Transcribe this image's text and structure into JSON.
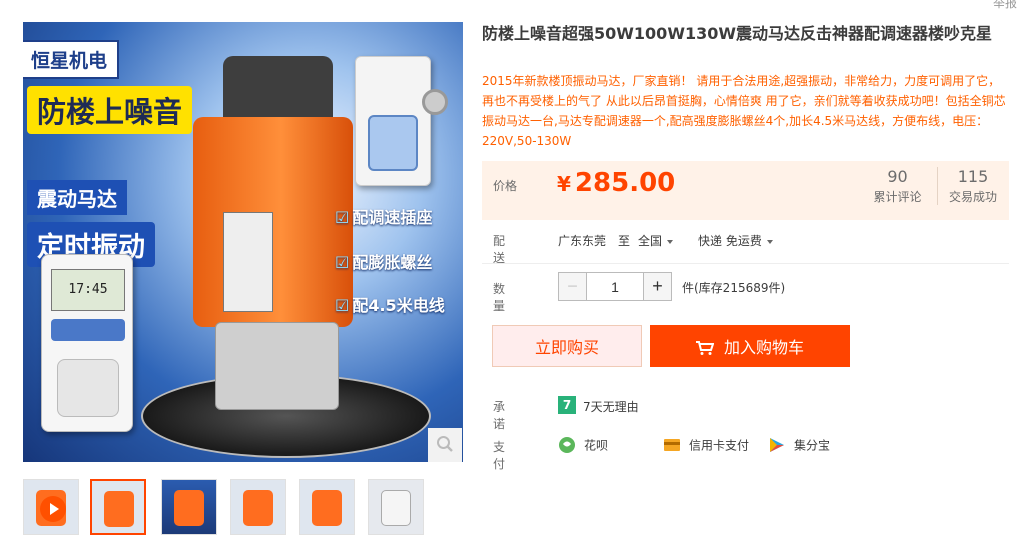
{
  "report": "举报",
  "main_image": {
    "brand": "恒星机电",
    "slogan_1": "防楼上噪音",
    "slogan_2": "震动马达",
    "slogan_3": "定时振动",
    "features": [
      "配调速插座",
      "配膨胀螺丝",
      "配4.5米电线"
    ],
    "timer_display": "17:45",
    "zoom_icon": "magnifier-icon"
  },
  "thumbnails": [
    {
      "name": "video",
      "icon": "play-icon"
    },
    {
      "name": "thumb-2",
      "active": true
    },
    {
      "name": "thumb-3"
    },
    {
      "name": "thumb-4"
    },
    {
      "name": "thumb-5"
    },
    {
      "name": "thumb-6"
    }
  ],
  "product": {
    "title": "防楼上噪音超强50W100W130W震动马达反击神器配调速器楼吵克星",
    "subtitle": "2015年新款楼顶振动马达，厂家直销！ 请用于合法用途,超强振动，非常给力，力度可调用了它，再也不再受楼上的气了 从此以后昂首挺胸，心情倍爽 用了它，亲们就等着收获成功吧！包括全铜芯振动马达一台,马达专配调速器一个,配高强度膨胀螺丝4个,加长4.5米马达线，方便布线，电压：220V,50-130W"
  },
  "price": {
    "label": "价格",
    "currency": "¥",
    "value": "285.00",
    "reviews_count": "90",
    "reviews_label": "累计评论",
    "deals_count": "115",
    "deals_label": "交易成功"
  },
  "shipping": {
    "label": "配送",
    "from": "广东东莞",
    "to_word": "至",
    "to": "全国",
    "method": "快递 免运费"
  },
  "quantity": {
    "label": "数量",
    "minus": "−",
    "value": "1",
    "plus": "+",
    "stock": "件(库存215689件)"
  },
  "buttons": {
    "buy_now": "立即购买",
    "add_cart": "加入购物车"
  },
  "promise": {
    "label": "承诺",
    "badge": "7",
    "text": "7天无理由"
  },
  "payment": {
    "label": "支付",
    "methods": [
      {
        "icon": "huabei-icon",
        "text": "花呗"
      },
      {
        "icon": "credit-card-icon",
        "text": "信用卡支付"
      },
      {
        "icon": "jifenbao-icon",
        "text": "集分宝"
      }
    ]
  },
  "colors": {
    "accent": "#ff4400",
    "price_bg": "#fff2e8",
    "subtitle": "#ff6000"
  }
}
